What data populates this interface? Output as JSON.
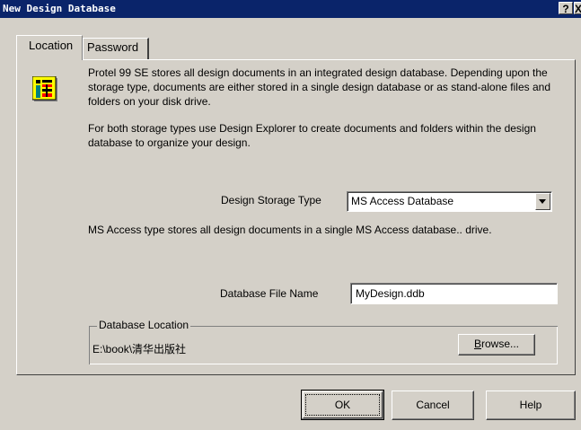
{
  "window": {
    "title": "New Design Database",
    "help_button": "?",
    "close_button": "X"
  },
  "tabs": [
    {
      "label": "Location",
      "active": true
    },
    {
      "label": "Password",
      "active": false
    }
  ],
  "location": {
    "intro": "Protel 99 SE stores all design documents in an integrated design database. Depending upon the storage type, documents are either stored in a single design database or as stand-alone files and folders on your disk drive.",
    "explorer_note": "For both storage types use Design Explorer to create documents and folders within the design database to organize your design.",
    "storage_type_label": "Design Storage Type",
    "storage_type_value": "MS Access Database",
    "storage_description": "MS Access type stores all design documents in a single MS Access database.. drive.",
    "file_name_label": "Database File Name",
    "file_name_value": "MyDesign.ddb",
    "db_location_title": "Database Location",
    "db_location_path": "E:\\book\\清华出版社",
    "browse_label": "rowse...",
    "browse_mnemonic": "B"
  },
  "buttons": {
    "ok": "OK",
    "cancel": "Cancel",
    "help": "Help"
  },
  "icons": {
    "database": "design-database-icon",
    "dropdown": "chevron-down-icon"
  },
  "colors": {
    "title_bar": "#0a246a",
    "dialog_face": "#d4d0c8"
  }
}
